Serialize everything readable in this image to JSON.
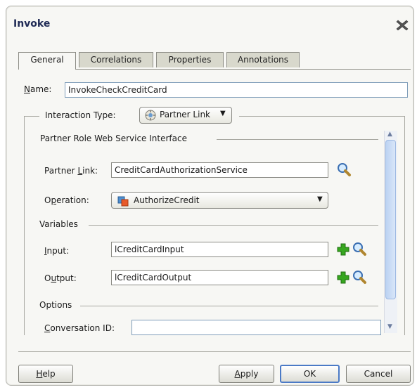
{
  "dialog": {
    "title": "Invoke"
  },
  "tabs": [
    "General",
    "Correlations",
    "Properties",
    "Annotations"
  ],
  "general": {
    "name_label": "Name:",
    "name_value": "InvokeCheckCreditCard",
    "interaction_type_label": "Interaction Type:",
    "interaction_type_value": "Partner Link",
    "partner_role_group": "Partner Role Web Service Interface",
    "partner_link_label": "Partner Link:",
    "partner_link_value": "CreditCardAuthorizationService",
    "operation_label": "Operation:",
    "operation_value": "AuthorizeCredit",
    "variables_group": "Variables",
    "input_label": "Input:",
    "input_value": "lCreditCardInput",
    "output_label": "Output:",
    "output_value": "lCreditCardOutput",
    "options_group": "Options",
    "conversation_id_label": "Conversation ID:",
    "conversation_id_value": ""
  },
  "buttons": {
    "help": "Help",
    "apply": "Apply",
    "ok": "OK",
    "cancel": "Cancel"
  },
  "icons": {
    "close": "close-x-icon",
    "partner_link": "partner-link-icon",
    "operation": "operation-icon",
    "search": "search-icon",
    "add": "add-plus-icon",
    "dropdown": "chevron-down-icon"
  },
  "colors": {
    "title": "#1f2a55",
    "focus": "#4b7ac6",
    "add": "#2f9e1f"
  }
}
